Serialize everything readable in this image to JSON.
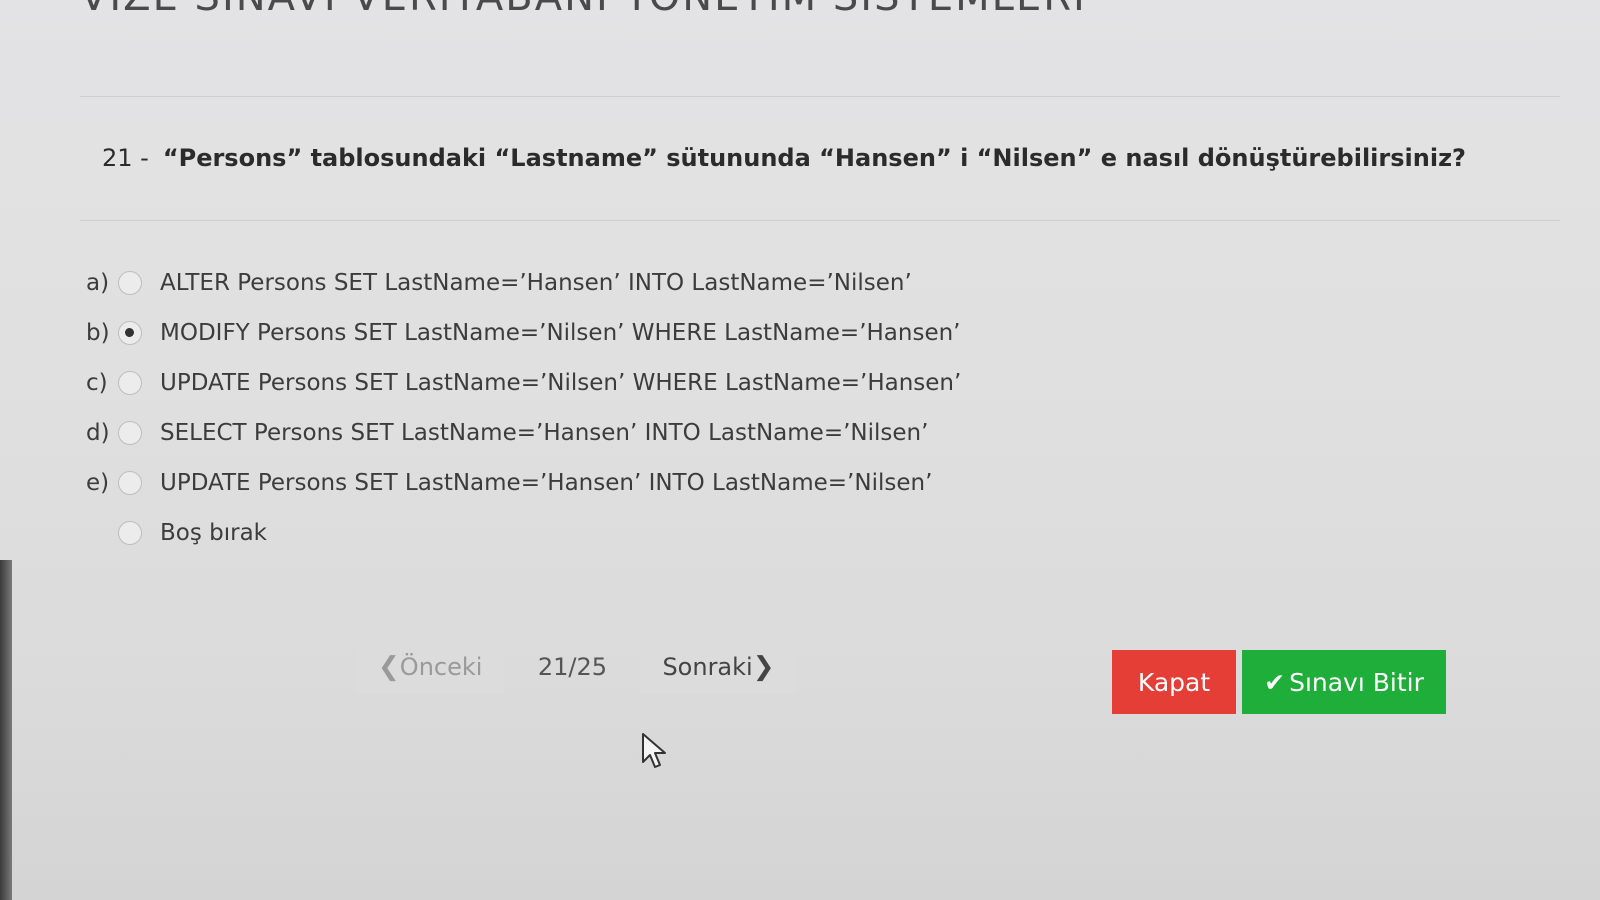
{
  "exam": {
    "title": "VİZE SINAVI VERİTABANI YÖNETİM SİSTEMLERİ"
  },
  "question": {
    "number": "21 -",
    "text": "“Persons” tablosundaki “Lastname” sütununda “Hansen” i “Nilsen” e nasıl dönüştürebilirsiniz?"
  },
  "options": [
    {
      "letter": "a)",
      "text": "ALTER Persons SET LastName=’Hansen’ INTO LastName=’Nilsen’",
      "selected": false
    },
    {
      "letter": "b)",
      "text": "MODIFY Persons SET LastName=’Nilsen’ WHERE LastName=’Hansen’",
      "selected": true
    },
    {
      "letter": "c)",
      "text": "UPDATE Persons SET LastName=’Nilsen’ WHERE LastName=’Hansen’",
      "selected": false
    },
    {
      "letter": "d)",
      "text": "SELECT Persons SET LastName=’Hansen’ INTO LastName=’Nilsen’",
      "selected": false
    },
    {
      "letter": "e)",
      "text": "UPDATE Persons SET LastName=’Hansen’ INTO LastName=’Nilsen’",
      "selected": false
    },
    {
      "letter": "",
      "text": "Boş bırak",
      "selected": false
    }
  ],
  "pager": {
    "prev_label": "Önceki",
    "counter": "21/25",
    "next_label": "Sonraki"
  },
  "actions": {
    "close_label": "Kapat",
    "finish_label": "Sınavı Bitir"
  },
  "colors": {
    "close": "#e53e37",
    "finish": "#1fae3a"
  },
  "icons": {
    "prev": "chevron-left-icon",
    "next": "chevron-right-icon",
    "finish": "check-icon",
    "cursor": "mouse-pointer-icon"
  }
}
